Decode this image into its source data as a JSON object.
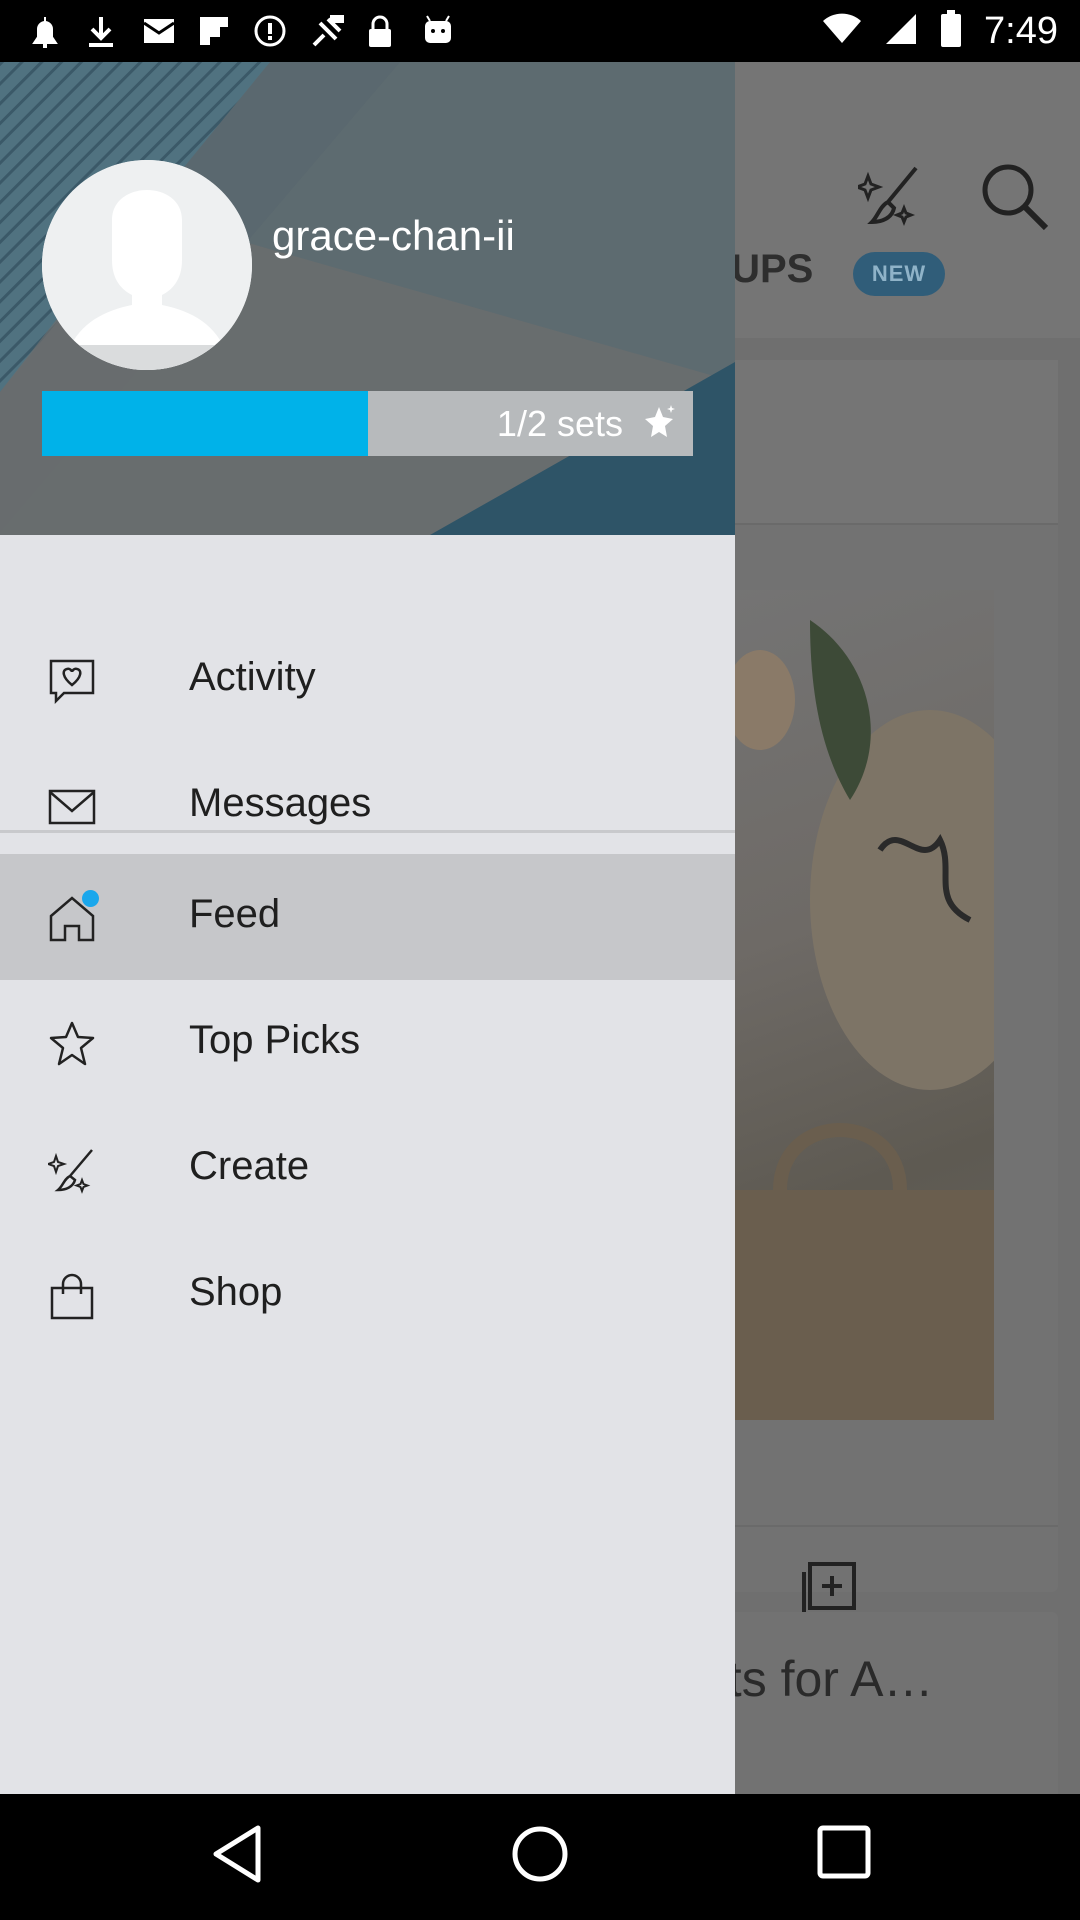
{
  "status_bar": {
    "time": "7:49",
    "icons": [
      "notification-icon",
      "download-icon",
      "mail-icon",
      "flipboard-icon",
      "alert-icon",
      "satellite-icon",
      "lock-icon",
      "android-icon",
      "wifi-icon",
      "signal-icon",
      "battery-icon"
    ]
  },
  "background_app": {
    "tab_label": "OUPS",
    "new_badge": "NEW",
    "card_title": "ets for A…"
  },
  "drawer": {
    "username": "grace-chan-ii",
    "progress": {
      "label": "1/2 sets",
      "fraction": 0.5
    },
    "items": [
      {
        "label": "Activity",
        "icon": "heart-message-icon",
        "active": false
      },
      {
        "label": "Messages",
        "icon": "envelope-icon",
        "active": false
      },
      {
        "label": "Feed",
        "icon": "home-icon",
        "active": true
      },
      {
        "label": "Top Picks",
        "icon": "star-icon",
        "active": false
      },
      {
        "label": "Create",
        "icon": "brush-sparkle-icon",
        "active": false
      },
      {
        "label": "Shop",
        "icon": "shopping-bag-icon",
        "active": false
      }
    ]
  },
  "colors": {
    "accent": "#00b2e9",
    "drawer_bg": "#e2e3e7",
    "active_item_bg": "#c6c7ca",
    "header_bg": "#5d6b70"
  }
}
